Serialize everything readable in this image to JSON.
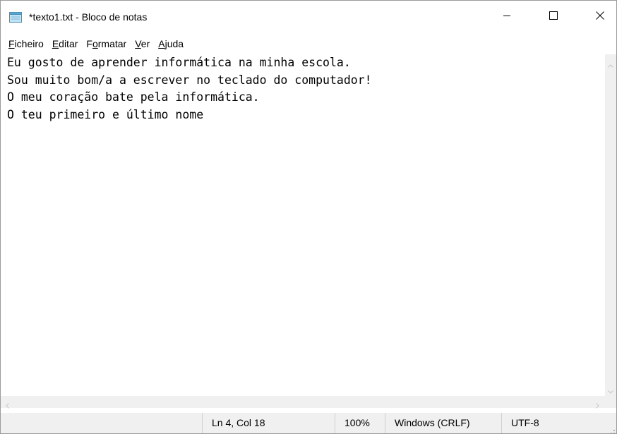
{
  "window": {
    "title": "*texto1.txt - Bloco de notas",
    "icon": "notepad-icon",
    "controls": [
      "minimize-icon",
      "maximize-icon",
      "close-icon"
    ]
  },
  "menubar": {
    "items": [
      {
        "accel": "F",
        "rest": "icheiro"
      },
      {
        "accel": "E",
        "rest": "ditar"
      },
      {
        "pre": "F",
        "accel": "o",
        "rest": "rmatar"
      },
      {
        "accel": "V",
        "rest": "er"
      },
      {
        "accel": "A",
        "rest": "juda"
      }
    ]
  },
  "editor": {
    "lines": [
      "Eu gosto de aprender informática na minha escola.",
      "Sou muito bom/a a escrever no teclado do computador!",
      "O meu coração bate pela informática.",
      "O teu primeiro e último nome"
    ]
  },
  "statusbar": {
    "position": "Ln 4, Col 18",
    "zoom": "100%",
    "line_ending": "Windows (CRLF)",
    "encoding": "UTF-8"
  }
}
